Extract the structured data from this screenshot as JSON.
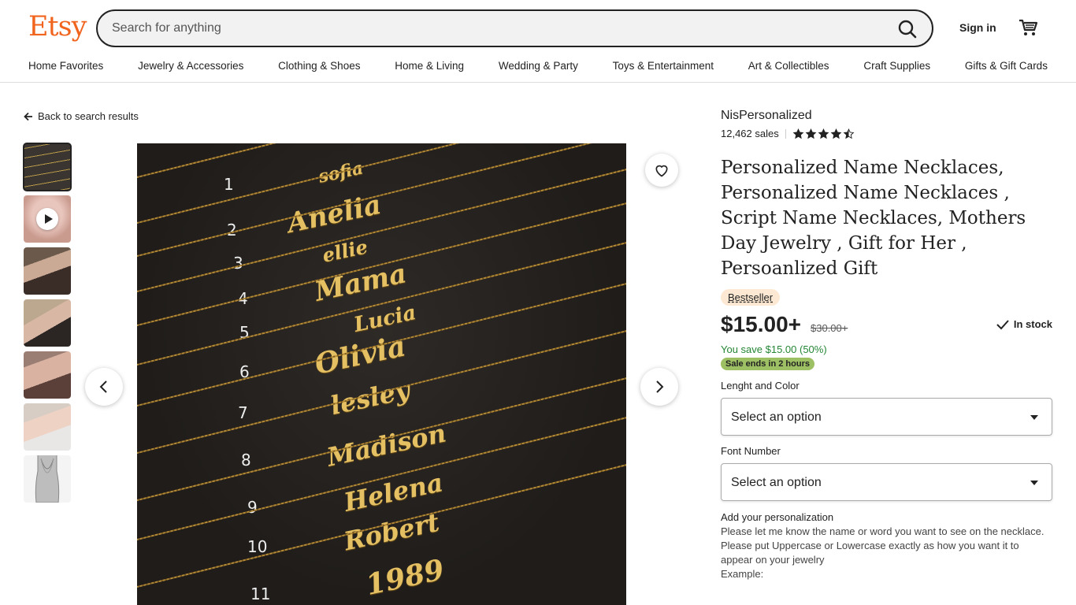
{
  "header": {
    "logo": "Etsy",
    "search_placeholder": "Search for anything",
    "sign_in": "Sign in"
  },
  "categories": [
    "Home Favorites",
    "Jewelry & Accessories",
    "Clothing & Shoes",
    "Home & Living",
    "Wedding & Party",
    "Toys & Entertainment",
    "Art & Collectibles",
    "Craft Supplies",
    "Gifts & Gift Cards"
  ],
  "back_link": "Back to search results",
  "image": {
    "numbers": [
      "1",
      "2",
      "3",
      "4",
      "5",
      "6",
      "7",
      "8",
      "9",
      "10",
      "11"
    ],
    "names": [
      "sofia",
      "Anelia",
      "ellie",
      "Mama",
      "Lucia",
      "Olivia",
      "lesley",
      "Madison",
      "Helena",
      "Robert",
      "1989"
    ]
  },
  "listing": {
    "shop": "NisPersonalized",
    "sales": "12,462 sales",
    "rating": 4.5,
    "title": "Personalized Name Necklaces, Personalized Name Necklaces , Script Name Necklaces, Mothers Day Jewelry , Gift for Her , Persoanlized Gift",
    "badge": "Bestseller",
    "price": "$15.00+",
    "old_price": "$30.00+",
    "stock": "In stock",
    "save": "You save $15.00 (50%)",
    "sale": "Sale ends in 2 hours",
    "option1_label": "Lenght and Color",
    "option1_value": "Select an option",
    "option2_label": "Font Number",
    "option2_value": "Select an option",
    "pers_title": "Add your personalization",
    "pers_line1": "Please let me know the name or word you want to see on the necklace.",
    "pers_line2": "Please put Uppercase or Lowercase exactly as how you want it to appear on your jewelry",
    "pers_line3": "Example:"
  },
  "colors": {
    "brand": "#f1641e",
    "save_green": "#258635",
    "sale_badge": "#9ec064",
    "bestseller_bg": "#fde9d3"
  }
}
